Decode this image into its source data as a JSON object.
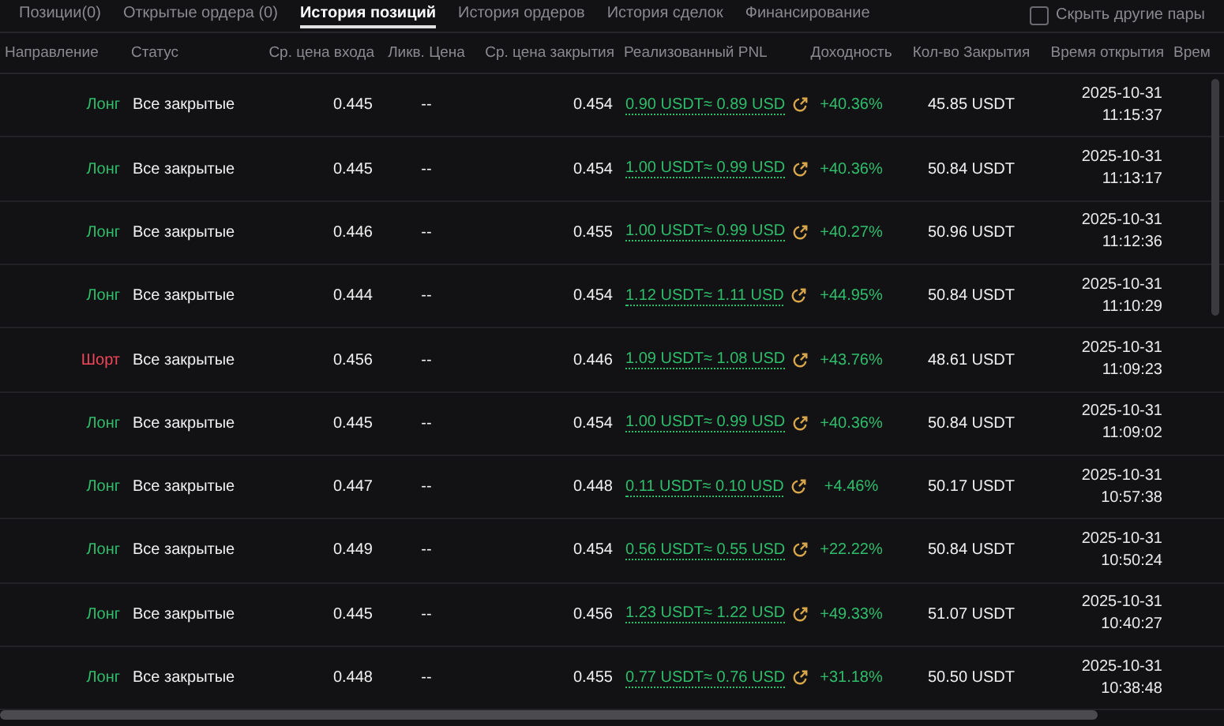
{
  "tabs": [
    {
      "label": "Позиции(0)",
      "selected": false
    },
    {
      "label": "Открытые ордера (0)",
      "selected": false
    },
    {
      "label": "История позиций",
      "selected": true
    },
    {
      "label": "История ордеров",
      "selected": false
    },
    {
      "label": "История сделок",
      "selected": false
    },
    {
      "label": "Финансирование",
      "selected": false
    }
  ],
  "hide_other_pairs": {
    "label": "Скрыть другие пары",
    "checked": false
  },
  "table": {
    "columns": [
      "Направление",
      "Статус",
      "Ср. цена входа",
      "Ликв. Цена",
      "Ср. цена закрытия",
      "Реализованный PNL",
      "Доходность",
      "Кол-во Закрытия",
      "Время открытия",
      "Врем"
    ],
    "rows": [
      {
        "side": {
          "label": "Лонг",
          "kind": "long"
        },
        "status": "Все закрытые",
        "entry": "0.445",
        "liq": "--",
        "close": "0.454",
        "pnl": "0.90 USDT≈ 0.89 USD",
        "yield": "+40.36%",
        "qty": "45.85 USDT",
        "date": "2025-10-31",
        "time": "11:15:37"
      },
      {
        "side": {
          "label": "Лонг",
          "kind": "long"
        },
        "status": "Все закрытые",
        "entry": "0.445",
        "liq": "--",
        "close": "0.454",
        "pnl": "1.00 USDT≈ 0.99 USD",
        "yield": "+40.36%",
        "qty": "50.84 USDT",
        "date": "2025-10-31",
        "time": "11:13:17"
      },
      {
        "side": {
          "label": "Лонг",
          "kind": "long"
        },
        "status": "Все закрытые",
        "entry": "0.446",
        "liq": "--",
        "close": "0.455",
        "pnl": "1.00 USDT≈ 0.99 USD",
        "yield": "+40.27%",
        "qty": "50.96 USDT",
        "date": "2025-10-31",
        "time": "11:12:36"
      },
      {
        "side": {
          "label": "Лонг",
          "kind": "long"
        },
        "status": "Все закрытые",
        "entry": "0.444",
        "liq": "--",
        "close": "0.454",
        "pnl": "1.12 USDT≈ 1.11 USD",
        "yield": "+44.95%",
        "qty": "50.84 USDT",
        "date": "2025-10-31",
        "time": "11:10:29"
      },
      {
        "side": {
          "label": "Шорт",
          "kind": "short"
        },
        "status": "Все закрытые",
        "entry": "0.456",
        "liq": "--",
        "close": "0.446",
        "pnl": "1.09 USDT≈ 1.08 USD",
        "yield": "+43.76%",
        "qty": "48.61 USDT",
        "date": "2025-10-31",
        "time": "11:09:23"
      },
      {
        "side": {
          "label": "Лонг",
          "kind": "long"
        },
        "status": "Все закрытые",
        "entry": "0.445",
        "liq": "--",
        "close": "0.454",
        "pnl": "1.00 USDT≈ 0.99 USD",
        "yield": "+40.36%",
        "qty": "50.84 USDT",
        "date": "2025-10-31",
        "time": "11:09:02"
      },
      {
        "side": {
          "label": "Лонг",
          "kind": "long"
        },
        "status": "Все закрытые",
        "entry": "0.447",
        "liq": "--",
        "close": "0.448",
        "pnl": "0.11 USDT≈ 0.10 USD",
        "yield": "+4.46%",
        "qty": "50.17 USDT",
        "date": "2025-10-31",
        "time": "10:57:38"
      },
      {
        "side": {
          "label": "Лонг",
          "kind": "long"
        },
        "status": "Все закрытые",
        "entry": "0.449",
        "liq": "--",
        "close": "0.454",
        "pnl": "0.56 USDT≈ 0.55 USD",
        "yield": "+22.22%",
        "qty": "50.84 USDT",
        "date": "2025-10-31",
        "time": "10:50:24"
      },
      {
        "side": {
          "label": "Лонг",
          "kind": "long"
        },
        "status": "Все закрытые",
        "entry": "0.445",
        "liq": "--",
        "close": "0.456",
        "pnl": "1.23 USDT≈ 1.22 USD",
        "yield": "+49.33%",
        "qty": "51.07 USDT",
        "date": "2025-10-31",
        "time": "10:40:27"
      },
      {
        "side": {
          "label": "Лонг",
          "kind": "long"
        },
        "status": "Все закрытые",
        "entry": "0.448",
        "liq": "--",
        "close": "0.455",
        "pnl": "0.77 USDT≈ 0.76 USD",
        "yield": "+31.18%",
        "qty": "50.50 USDT",
        "date": "2025-10-31",
        "time": "10:38:48"
      }
    ]
  }
}
